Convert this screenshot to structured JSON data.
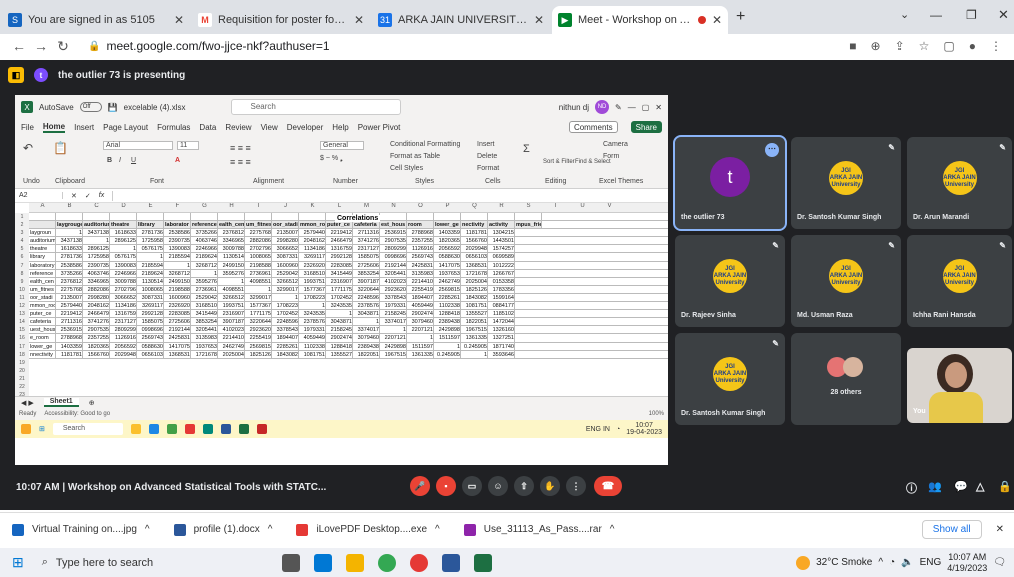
{
  "browser": {
    "tabs": [
      {
        "label": "You are signed in as 5105",
        "color": "#1565c0",
        "glyph": "S"
      },
      {
        "label": "Requisition for poster for the Trai",
        "color": "#ea4335",
        "glyph": "M"
      },
      {
        "label": "ARKA JAIN UNIVERSITY - Calend",
        "color": "#1a73e8",
        "glyph": "31"
      },
      {
        "label": "Meet - Workshop on Advanc",
        "color": "#00832d",
        "glyph": "▶"
      }
    ],
    "url": "meet.google.com/fwo-jjce-nkf?authuser=1"
  },
  "meet": {
    "presenting": "the outlier 73 is presenting",
    "meeting_title": "10:07 AM  |  Workshop on Advanced Statistical Tools with STATC...",
    "participants": [
      {
        "name": "the outlier 73",
        "initial": "t"
      },
      {
        "name": "Dr. Santosh Kumar Singh"
      },
      {
        "name": "Dr. Arun Marandi"
      },
      {
        "name": "Dr. Rajeev Sinha"
      },
      {
        "name": "Md. Usman Raza"
      },
      {
        "name": "Ichha Rani Hansda"
      },
      {
        "name": "Dr. Santosh Kumar Singh"
      },
      {
        "name": "28 others"
      },
      {
        "name": "You"
      }
    ],
    "logo_lines": [
      "JGI",
      "ARKA JAIN",
      "University"
    ]
  },
  "excel": {
    "autosave": "AutoSave",
    "toggle": "Off",
    "filename": "excelable (4).xlsx",
    "search": "Search",
    "user": "nithun dj",
    "menu": [
      "File",
      "Home",
      "Insert",
      "Page Layout",
      "Formulas",
      "Data",
      "Review",
      "View",
      "Developer",
      "Help",
      "Power Pivot"
    ],
    "comments": "Comments",
    "share": "Share",
    "ribbon": {
      "font": "Arial",
      "size": "11",
      "format": "General",
      "cond": "Conditional Formatting",
      "table": "Format as Table",
      "cellstyles": "Cell Styles",
      "insert": "Insert",
      "delete": "Delete",
      "formatbtn": "Format",
      "sort": "Sort & Filter",
      "find": "Find & Select",
      "camera": "Camera",
      "form": "Form",
      "groups": [
        "Undo",
        "Clipboard",
        "Font",
        "Alignment",
        "Number",
        "Styles",
        "Cells",
        "Editing",
        "Excel Themes"
      ]
    },
    "namebox": "A2",
    "fx": "fx",
    "corr_title": "Correlations",
    "columns": [
      "A",
      "B",
      "C",
      "D",
      "E",
      "F",
      "G",
      "H",
      "I",
      "J",
      "K",
      "L",
      "M",
      "N",
      "O",
      "P",
      "Q",
      "R",
      "S",
      "T",
      "U",
      "V"
    ],
    "header_row": [
      "",
      "laygrouge",
      "auditorium",
      "theatre",
      "library",
      "laborator",
      "reference",
      "ealth_cen",
      "um_fitnes",
      "oor_stadi",
      "mmon_roo",
      "puter_ce",
      "cafeteria",
      "est_hous",
      "room",
      "lower_ge",
      "nectivity",
      "activity",
      "mpus_frie"
    ],
    "rows": [
      [
        "laygroun",
        "1",
        "3437138",
        "1618633",
        "2781736",
        "2538586",
        "3735266",
        "2376812",
        "2275768",
        "2135007",
        "2579440",
        "2219412",
        "2711316",
        "2536915",
        "2788968",
        "1403359",
        "1181781",
        "1304215"
      ],
      [
        "auditorium",
        "3437138",
        "1",
        "2896125",
        "1725958",
        "2390735",
        "4063746",
        "3346965",
        "2882086",
        "2998280",
        "2048162",
        "2466479",
        "3741276",
        "2907535",
        "2357255",
        "1820365",
        "1566760",
        "1443501"
      ],
      [
        "theatre",
        "1618633",
        "2896125",
        "1",
        "0576175",
        "1390083",
        "2246966",
        "3009788",
        "2702796",
        "3066652",
        "1134186",
        "1316759",
        "2317127",
        "2809299",
        "1126916",
        "2056592",
        "2029948",
        "1574257"
      ],
      [
        "library",
        "2781736",
        "1725958",
        "0576175",
        "1",
        "2185594",
        "2189624",
        "1130514",
        "1008065",
        "3087331",
        "3269117",
        "2992128",
        "1585075",
        "0998696",
        "2569743",
        "0588630",
        "0656103",
        "0699589"
      ],
      [
        "laboratory",
        "2538586",
        "2390735",
        "1390083",
        "2185594",
        "1",
        "3268712",
        "2499150",
        "2198588",
        "1600960",
        "2326920",
        "2283085",
        "2725606",
        "2192144",
        "2425831",
        "1417075",
        "1368531",
        "1012222"
      ],
      [
        "reference",
        "3735266",
        "4063746",
        "2246966",
        "2189624",
        "3268712",
        "1",
        "3595276",
        "2736961",
        "2529042",
        "3168510",
        "3415449",
        "3853254",
        "3205441",
        "3135983",
        "1937653",
        "1721678",
        "1266767"
      ],
      [
        "ealth_cen",
        "2376812",
        "3346965",
        "3009788",
        "1130514",
        "2499150",
        "3595276",
        "1",
        "4098551",
        "3266512",
        "1993751",
        "2316907",
        "3907187",
        "4102023",
        "2214410",
        "2462749",
        "2025004",
        "0153358"
      ],
      [
        "um_fitnes",
        "2275768",
        "2882086",
        "2702796",
        "1008065",
        "2198588",
        "2736961",
        "4098551",
        "1",
        "3299017",
        "1577367",
        "1771175",
        "3220644",
        "2923620",
        "2255419",
        "2569815",
        "1825126",
        "1783356"
      ],
      [
        "oor_stadi",
        "2135007",
        "2998280",
        "3066652",
        "3087331",
        "1600960",
        "2529042",
        "3266512",
        "3299017",
        "1",
        "1708223",
        "1702452",
        "2248596",
        "3378543",
        "1894407",
        "2285261",
        "1843082",
        "1599164"
      ],
      [
        "mmon_roo",
        "2579440",
        "2048162",
        "1134186",
        "3269117",
        "2326920",
        "3168510",
        "1993751",
        "1577367",
        "1708223",
        "1",
        "3243535",
        "2378576",
        "1979331",
        "4059449",
        "1102338",
        "1081751",
        "0884177"
      ],
      [
        "puter_ce",
        "2219412",
        "2466479",
        "1316759",
        "2992128",
        "2283085",
        "3415449",
        "2316907",
        "1771175",
        "1702452",
        "3243535",
        "1",
        "3043871",
        "2158245",
        "2902474",
        "1288418",
        "1355527",
        "1185102"
      ],
      [
        "cafeteria",
        "2711316",
        "3741276",
        "2317127",
        "1585075",
        "2725606",
        "3853254",
        "3907187",
        "3220644",
        "2248596",
        "2378576",
        "3043871",
        "1",
        "3374017",
        "3079460",
        "2389438",
        "1822051",
        "1472044"
      ],
      [
        "uest_hous",
        "2536915",
        "2907535",
        "2809299",
        "0998696",
        "2192144",
        "3205441",
        "4102023",
        "2923620",
        "3378543",
        "1979331",
        "2158245",
        "3374017",
        "1",
        "2207121",
        "2429898",
        "1967515",
        "1326160"
      ],
      [
        "e_room",
        "2788968",
        "2357255",
        "1126916",
        "2569743",
        "2425831",
        "3135983",
        "2214410",
        "2255419",
        "1894407",
        "4059449",
        "2902474",
        "3079460",
        "2207121",
        "1",
        "1511597",
        "1361335",
        "1327251"
      ],
      [
        "lower_ge",
        "1403359",
        "1820365",
        "2056592",
        "0588630",
        "1417075",
        "1937653",
        "2462749",
        "2569815",
        "2285261",
        "1102338",
        "1288418",
        "2389438",
        "2429898",
        "1511597",
        "1",
        "0.245905",
        "1871740"
      ],
      [
        "nnectivity",
        "1181781",
        "1566760",
        "2029948",
        "0656103",
        "1368531",
        "1721678",
        "2025004",
        "1825126",
        "1843082",
        "1081751",
        "1355527",
        "1822051",
        "1967515",
        "1361335",
        "0.245905",
        "1",
        "3593646"
      ]
    ],
    "row_numbers": [
      "1",
      "2",
      "3",
      "4",
      "5",
      "6",
      "7",
      "8",
      "9",
      "10",
      "11",
      "12",
      "13",
      "14",
      "15",
      "16",
      "17",
      "18",
      "19",
      "20",
      "21",
      "22",
      "23"
    ],
    "sheet": "Sheet1",
    "status": [
      "Ready",
      "Accessibility: Good to go"
    ],
    "zoom": "100%",
    "vm_search": "Search",
    "vm_clock": [
      "10:07",
      "19-04-2023"
    ],
    "vm_lang": [
      "ENG",
      "IN"
    ]
  },
  "downloads": [
    {
      "name": "Virtual Training on....jpg",
      "color": "#1565c0"
    },
    {
      "name": "profile (1).docx",
      "color": "#2b579a"
    },
    {
      "name": "iLovePDF Desktop....exe",
      "color": "#e53935"
    },
    {
      "name": "Use_31113_As_Pass....rar",
      "color": "#8e24aa"
    }
  ],
  "show_all": "Show all",
  "taskbar": {
    "search": "Type here to search",
    "weather": "32°C  Smoke",
    "lang": "ENG",
    "time": "10:07 AM",
    "date": "4/19/2023"
  }
}
